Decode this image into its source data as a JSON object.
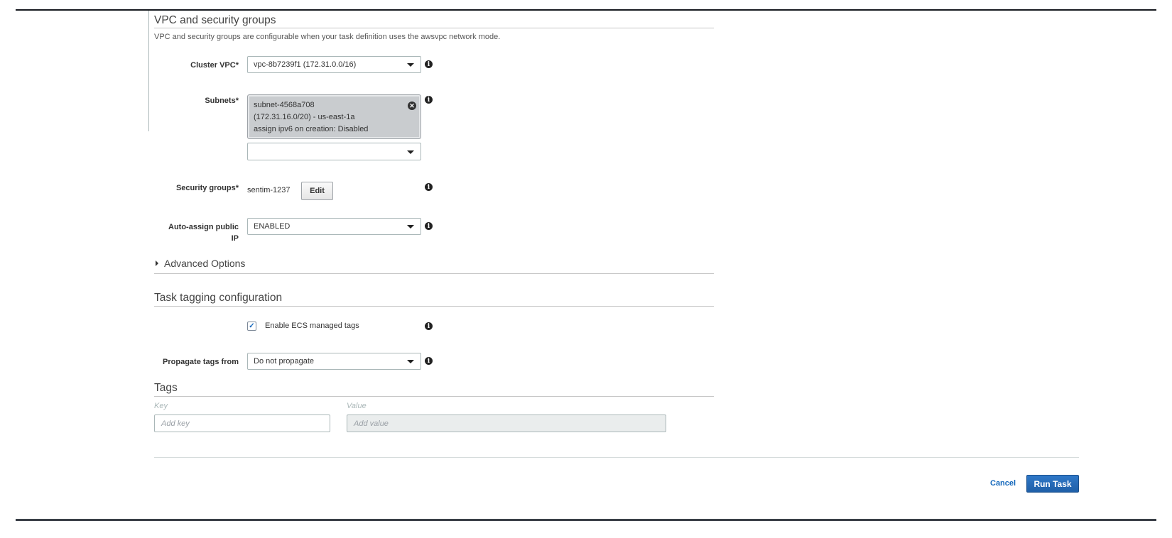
{
  "vpc_section": {
    "title": "VPC and security groups",
    "description": "VPC and security groups are configurable when your task definition uses the awsvpc network mode."
  },
  "cluster_vpc": {
    "label": "Cluster VPC*",
    "value": "vpc-8b7239f1 (172.31.0.0/16)"
  },
  "subnets": {
    "label": "Subnets*",
    "selected": [
      {
        "line1": "subnet-4568a708",
        "line2": "(172.31.16.0/20) - us-east-1a",
        "line3": "assign ipv6 on creation: Disabled"
      }
    ],
    "select_value": ""
  },
  "security_groups": {
    "label": "Security groups*",
    "value": "sentim-1237",
    "edit_label": "Edit"
  },
  "auto_assign_ip": {
    "label_line1": "Auto-assign public",
    "label_line2": "IP",
    "value": "ENABLED"
  },
  "advanced_options": {
    "label": "Advanced Options"
  },
  "tagging_section": {
    "title": "Task tagging configuration",
    "enable_ecs_tags": {
      "label": "Enable ECS managed tags",
      "checked": true
    },
    "propagate": {
      "label": "Propagate tags from",
      "value": "Do not propagate"
    }
  },
  "tags_section": {
    "title": "Tags",
    "key_label": "Key",
    "value_label": "Value",
    "key_placeholder": "Add key",
    "value_placeholder": "Add value"
  },
  "footer": {
    "cancel_label": "Cancel",
    "run_label": "Run Task"
  },
  "icons": {
    "info": "info-icon",
    "caret": "caret-down-icon",
    "remove": "remove-circle-icon",
    "expand": "caret-right-icon",
    "check": "checkmark-icon"
  },
  "colors": {
    "primary": "#1f5fa8",
    "link": "#1166bb"
  }
}
